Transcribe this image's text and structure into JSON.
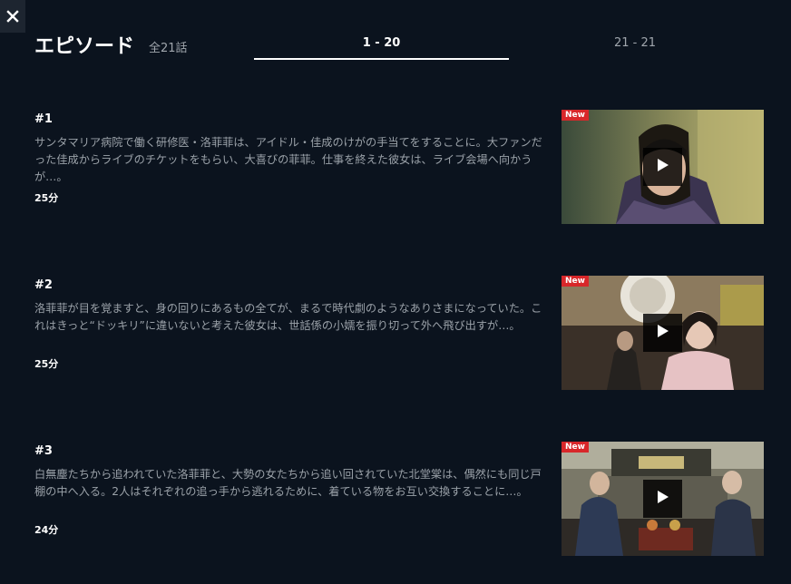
{
  "header": {
    "title": "エピソード",
    "count": "全21話"
  },
  "tabs": [
    {
      "label": "1 - 20",
      "active": true
    },
    {
      "label": "21 - 21",
      "active": false
    }
  ],
  "episodes": [
    {
      "number": "#1",
      "description": "サンタマリア病院で働く研修医・洛菲菲は、アイドル・佳成のけがの手当てをすることに。大ファンだった佳成からライブのチケットをもらい、大喜びの菲菲。仕事を終えた彼女は、ライブ会場へ向かうが…。",
      "duration": "25分",
      "badge": "New"
    },
    {
      "number": "#2",
      "description": "洛菲菲が目を覚ますと、身の回りにあるもの全てが、まるで時代劇のようなありさまになっていた。これはきっと“ドッキリ”に違いないと考えた彼女は、世話係の小嬬を振り切って外へ飛び出すが…。",
      "duration": "25分",
      "badge": "New"
    },
    {
      "number": "#3",
      "description": "白無塵たちから追われていた洛菲菲と、大勢の女たちから追い回されていた北堂棠は、偶然にも同じ戸棚の中へ入る。2人はそれぞれの追っ手から逃れるために、着ている物をお互い交換することに…。",
      "duration": "24分",
      "badge": "New"
    }
  ],
  "icons": {
    "close": "close-icon",
    "play": "play-icon"
  },
  "colors": {
    "background": "#0b131e",
    "new_badge": "#d8272a",
    "text_primary": "#ffffff",
    "text_secondary": "#9ba2a9"
  }
}
